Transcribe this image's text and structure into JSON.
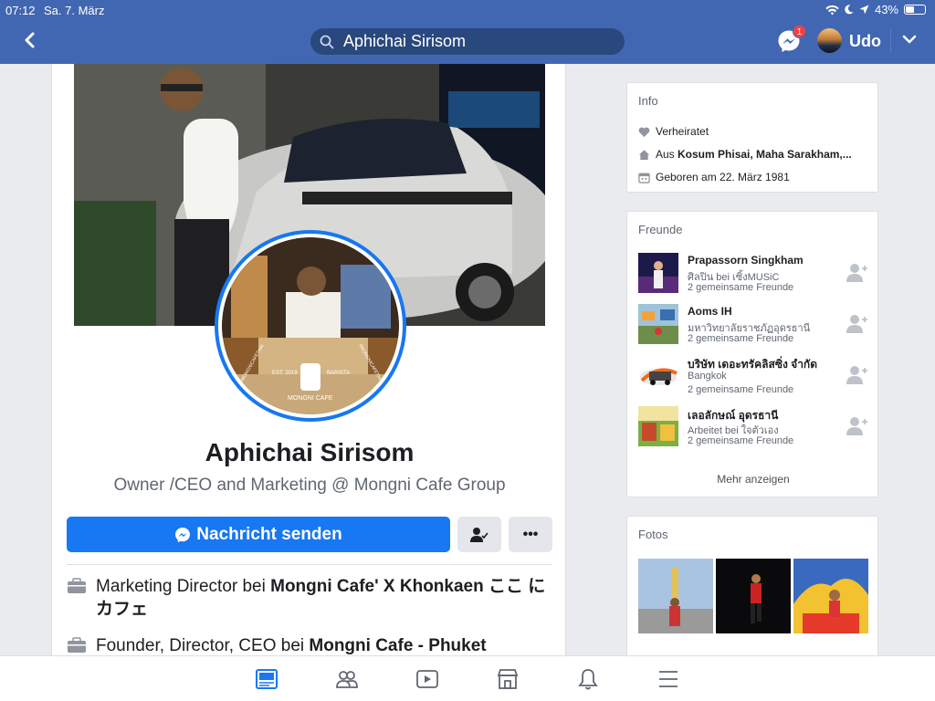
{
  "status_bar": {
    "time": "07:12",
    "date": "Sa. 7. März",
    "battery": "43%",
    "battery_level": 0.43
  },
  "header": {
    "search_value": "Aphichai Sirisom",
    "messenger_badge": "1",
    "user_name": "Udo"
  },
  "profile": {
    "name": "Aphichai Sirisom",
    "bio": "Owner /CEO and  Marketing @ Mongni Cafe Group",
    "message_button": "Nachricht senden",
    "more_button": "•••",
    "profile_pic_text": {
      "est": "EST. 2019",
      "barista": "BARISTA",
      "brand": "MONGNI CAFE",
      "hashtag": "#MONGNICAFETHAI"
    },
    "work": [
      {
        "prefix": "Marketing Director bei ",
        "org": "Mongni Cafe' X Khonkaen ここ に カフェ"
      },
      {
        "prefix": "Founder, Director, CEO bei ",
        "org": "Mongni Cafe - Phuket"
      }
    ]
  },
  "info": {
    "title": "Info",
    "relationship": "Verheiratet",
    "from_prefix": "Aus ",
    "from_place": "Kosum Phisai, Maha Sarakham,...",
    "birthday": "Geboren am 22. März 1981"
  },
  "friends": {
    "title": "Freunde",
    "items": [
      {
        "name": "Prapassorn Singkham",
        "sub": "ศิลปิน bei เซิ้งMUSiC",
        "mutual": "2 gemeinsame Freunde"
      },
      {
        "name": "Aoms IH",
        "sub": "มหาวิทยาลัยราชภัฏอุดรธานี",
        "mutual": "2 gemeinsame Freunde"
      },
      {
        "name": "บริษัท เดอะทรัคลิสซิ่ง จำกัด",
        "sub": "Bangkok",
        "mutual": "2 gemeinsame Freunde"
      },
      {
        "name": "เลอลักษณ์ อุดรธานี",
        "sub": "Arbeitet bei ใจตัวเอง",
        "mutual": "2 gemeinsame Freunde"
      }
    ],
    "more": "Mehr anzeigen"
  },
  "photos": {
    "title": "Fotos"
  },
  "colors": {
    "header": "#4267b2",
    "primary": "#1877f2",
    "badge": "#fa3e3e"
  }
}
